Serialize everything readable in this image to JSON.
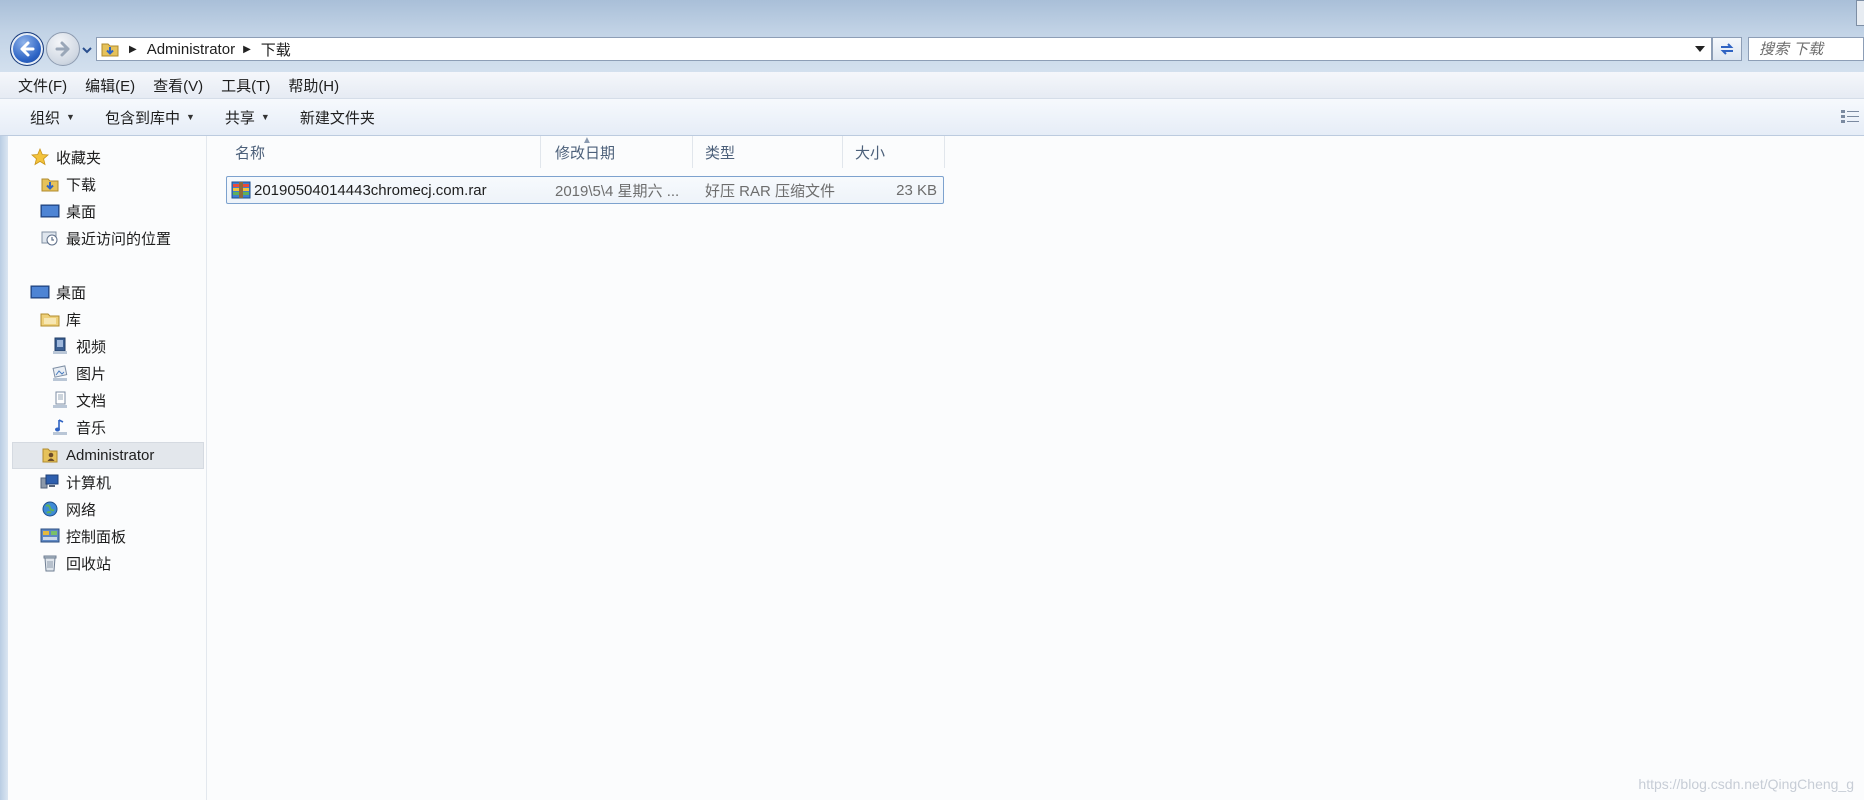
{
  "navigation": {
    "breadcrumb": [
      "Administrator",
      "下载"
    ],
    "search_placeholder": "搜索 下载"
  },
  "menu": [
    "文件(F)",
    "编辑(E)",
    "查看(V)",
    "工具(T)",
    "帮助(H)"
  ],
  "commands": [
    {
      "label": "组织",
      "has_dropdown": true
    },
    {
      "label": "包含到库中",
      "has_dropdown": true
    },
    {
      "label": "共享",
      "has_dropdown": true
    },
    {
      "label": "新建文件夹",
      "has_dropdown": false
    }
  ],
  "sidebar": {
    "favorites": {
      "label": "收藏夹",
      "items": [
        "下载",
        "桌面",
        "最近访问的位置"
      ]
    },
    "desktop": {
      "label": "桌面",
      "library": {
        "label": "库",
        "items": [
          "视频",
          "图片",
          "文档",
          "音乐"
        ]
      },
      "items": [
        "Administrator",
        "计算机",
        "网络",
        "控制面板",
        "回收站"
      ],
      "selected": "Administrator"
    }
  },
  "file_list": {
    "columns": [
      "名称",
      "修改日期",
      "类型",
      "大小"
    ],
    "rows": [
      {
        "name": "20190504014443chromecj.com.rar",
        "date": "2019\\5\\4 星期六 ...",
        "type": "好压 RAR 压缩文件",
        "size": "23 KB"
      }
    ]
  },
  "watermark": "https://blog.csdn.net/QingCheng_g",
  "colors": {
    "accent": "#2b62c4",
    "selection_border": "#7da2ce",
    "header_text": "#4c607a"
  }
}
